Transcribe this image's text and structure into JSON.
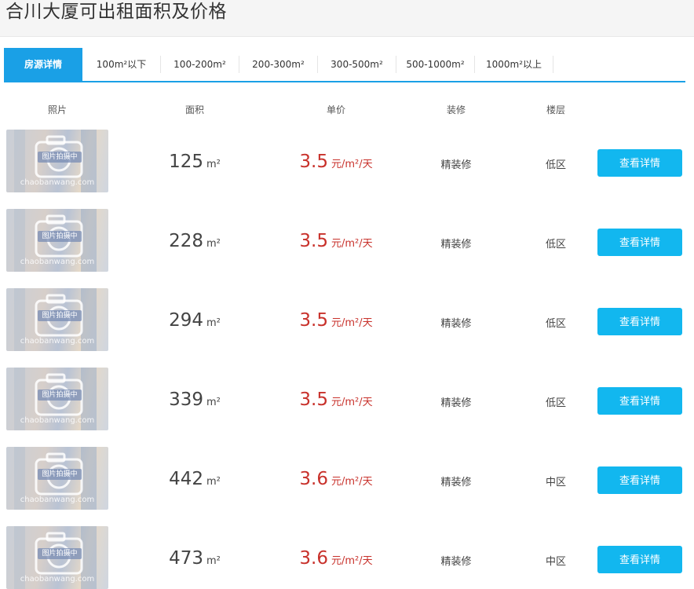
{
  "page": {
    "title": "合川大厦可出租面积及价格"
  },
  "tabs": [
    {
      "label": "房源详情",
      "active": true
    },
    {
      "label": "100m²以下",
      "active": false
    },
    {
      "label": "100-200m²",
      "active": false
    },
    {
      "label": "200-300m²",
      "active": false
    },
    {
      "label": "300-500m²",
      "active": false
    },
    {
      "label": "500-1000m²",
      "active": false
    },
    {
      "label": "1000m²以上",
      "active": false
    }
  ],
  "columns": {
    "photo": "照片",
    "area": "面积",
    "price": "单价",
    "decoration": "装修",
    "floor": "楼层"
  },
  "placeholder": {
    "badge": "图片拍摄中",
    "watermark": "chaobanwang.com"
  },
  "units": {
    "area": "m²",
    "price": "元/m²/天"
  },
  "button_label": "查看详情",
  "listings": [
    {
      "area": "125",
      "price": "3.5",
      "decoration": "精装修",
      "floor": "低区"
    },
    {
      "area": "228",
      "price": "3.5",
      "decoration": "精装修",
      "floor": "低区"
    },
    {
      "area": "294",
      "price": "3.5",
      "decoration": "精装修",
      "floor": "低区"
    },
    {
      "area": "339",
      "price": "3.5",
      "decoration": "精装修",
      "floor": "低区"
    },
    {
      "area": "442",
      "price": "3.6",
      "decoration": "精装修",
      "floor": "中区"
    },
    {
      "area": "473",
      "price": "3.6",
      "decoration": "精装修",
      "floor": "中区"
    }
  ],
  "colors": {
    "accent": "#1aa0e6",
    "button": "#12b7ef",
    "price": "#c8312b"
  }
}
